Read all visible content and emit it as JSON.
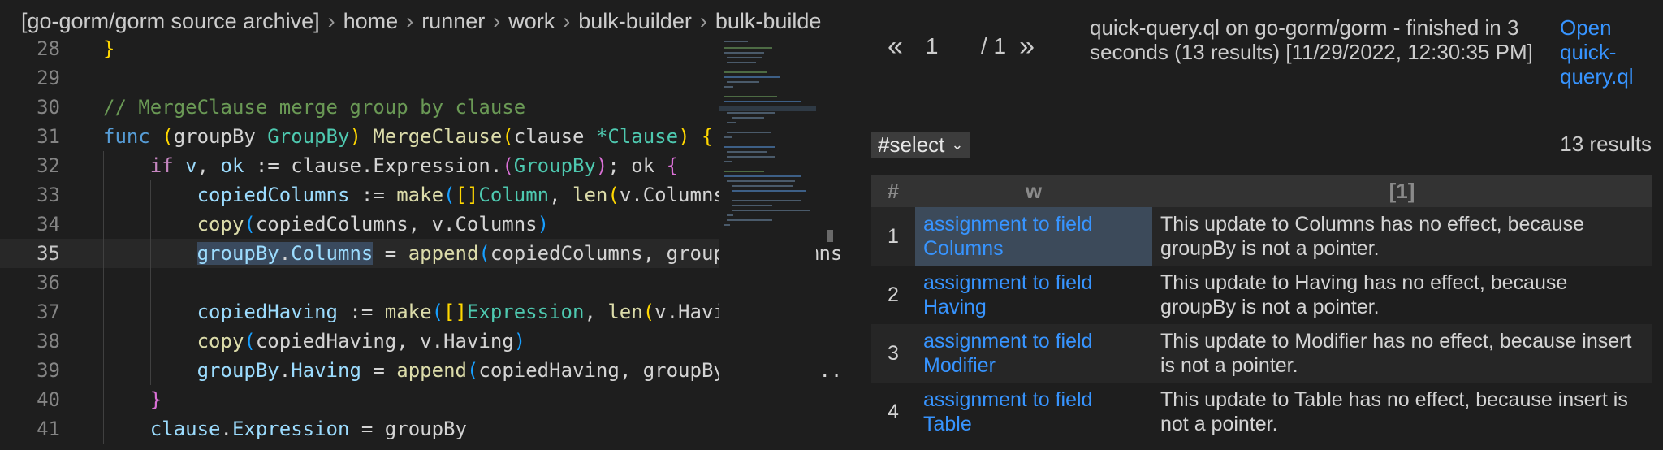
{
  "editor": {
    "breadcrumb": [
      "[go-gorm/gorm source archive]",
      "home",
      "runner",
      "work",
      "bulk-builder",
      "bulk-builde"
    ],
    "current_line": "35"
  },
  "results": {
    "pager": {
      "prev_icon": "«",
      "page": "1",
      "total": "/ 1",
      "next_icon": "»"
    },
    "status": "quick-query.ql on go-gorm/gorm - finished in 3 seconds (13 results) [11/29/2022, 12:30:35 PM]",
    "open_link": "Open quick-query.ql",
    "select_label": "#select",
    "count": "13 results",
    "headers": [
      "#",
      "w",
      "[1]"
    ],
    "rows": [
      {
        "n": "1",
        "w": "assignment to field Columns",
        "msg": "This update to Columns has no effect, because groupBy is not a pointer."
      },
      {
        "n": "2",
        "w": "assignment to field Having",
        "msg": "This update to Having has no effect, because groupBy is not a pointer."
      },
      {
        "n": "3",
        "w": "assignment to field Modifier",
        "msg": "This update to Modifier has no effect, because insert is not a pointer."
      },
      {
        "n": "4",
        "w": "assignment to field Table",
        "msg": "This update to Table has no effect, because insert is not a pointer."
      }
    ]
  },
  "colors": {
    "link": "#3794ff",
    "selected_row": "#3c4a5a",
    "editor_bg": "#1e1e1e"
  }
}
